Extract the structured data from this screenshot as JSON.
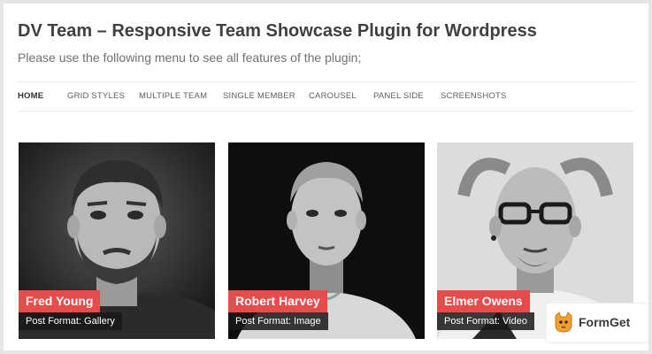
{
  "header": {
    "title": "DV Team – Responsive Team Showcase Plugin for Wordpress",
    "description": "Please use the following menu to see all features of the plugin;"
  },
  "nav": {
    "items": [
      "HOME",
      "GRID STYLES",
      "MULTIPLE TEAM",
      "SINGLE MEMBER",
      "CAROUSEL",
      "PANEL SIDE",
      "SCREENSHOTS"
    ],
    "active": "HOME"
  },
  "members": [
    {
      "name": "Fred Young",
      "format": "Post Format: Gallery"
    },
    {
      "name": "Robert Harvey",
      "format": "Post Format: Image"
    },
    {
      "name": "Elmer Owens",
      "format": "Post Format: Video"
    }
  ],
  "badge": {
    "text": "FormGet",
    "icon": "cat-logo-icon"
  },
  "colors": {
    "accent": "#e74c4c",
    "label_bg": "#1a1a1a",
    "title": "#404040"
  }
}
